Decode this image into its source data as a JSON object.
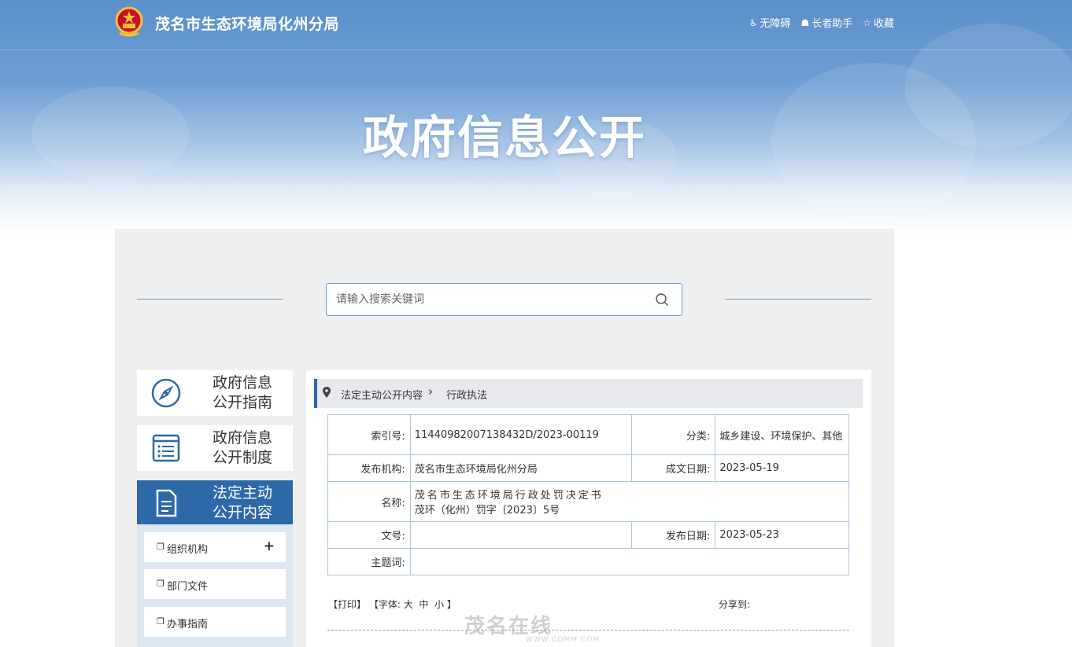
{
  "header": {
    "site_title": "茂名市生态环境局化州分局",
    "tools": [
      {
        "icon": "wheelchair-icon",
        "label": "无障碍"
      },
      {
        "icon": "elder-icon",
        "label": "长者助手"
      },
      {
        "icon": "star-icon",
        "label": "收藏"
      }
    ]
  },
  "hero": {
    "title": "政府信息公开"
  },
  "search": {
    "placeholder": "请输入搜索关键词"
  },
  "sidebar": {
    "cards": [
      {
        "line1": "政府信息",
        "line2": "公开指南",
        "icon": "compass-icon",
        "active": false
      },
      {
        "line1": "政府信息",
        "line2": "公开制度",
        "icon": "list-icon",
        "active": false
      },
      {
        "line1": "法定主动",
        "line2": "公开内容",
        "icon": "document-icon",
        "active": true
      }
    ],
    "sub_items": [
      {
        "label": "组织机构",
        "has_plus": true
      },
      {
        "label": "部门文件",
        "has_plus": false
      },
      {
        "label": "办事指南",
        "has_plus": false
      }
    ]
  },
  "breadcrumb": {
    "level1": "法定主动公开内容",
    "level2": "行政执法"
  },
  "meta": {
    "index_label": "索引号:",
    "index_value": "11440982007138432D/2023-00119",
    "category_label": "分类:",
    "category_value": "城乡建设、环境保护、其他",
    "publisher_label": "发布机构:",
    "publisher_value": "茂名市生态环境局化州分局",
    "created_label": "成文日期:",
    "created_value": "2023-05-19",
    "name_label": "名称:",
    "name_line1": "茂名市生态环境局行政处罚决定书",
    "name_line2": "茂环（化州）罚字〔2023〕5号",
    "docno_label": "文号:",
    "docno_value": "",
    "published_label": "发布日期:",
    "published_value": "2023-05-23",
    "keywords_label": "主题词:",
    "keywords_value": ""
  },
  "actions": {
    "print": "【打印】",
    "font_prefix": "【字体:",
    "font_large": "大",
    "font_medium": "中",
    "font_small": "小",
    "font_suffix": "】",
    "share_label": "分享到:"
  },
  "watermark": {
    "text": "茂名在线",
    "url": "WWW.GDMM.COM"
  },
  "colors": {
    "brand": "#2d69a8",
    "border": "#a9c4df",
    "hero_top": "#5a8fc9"
  }
}
